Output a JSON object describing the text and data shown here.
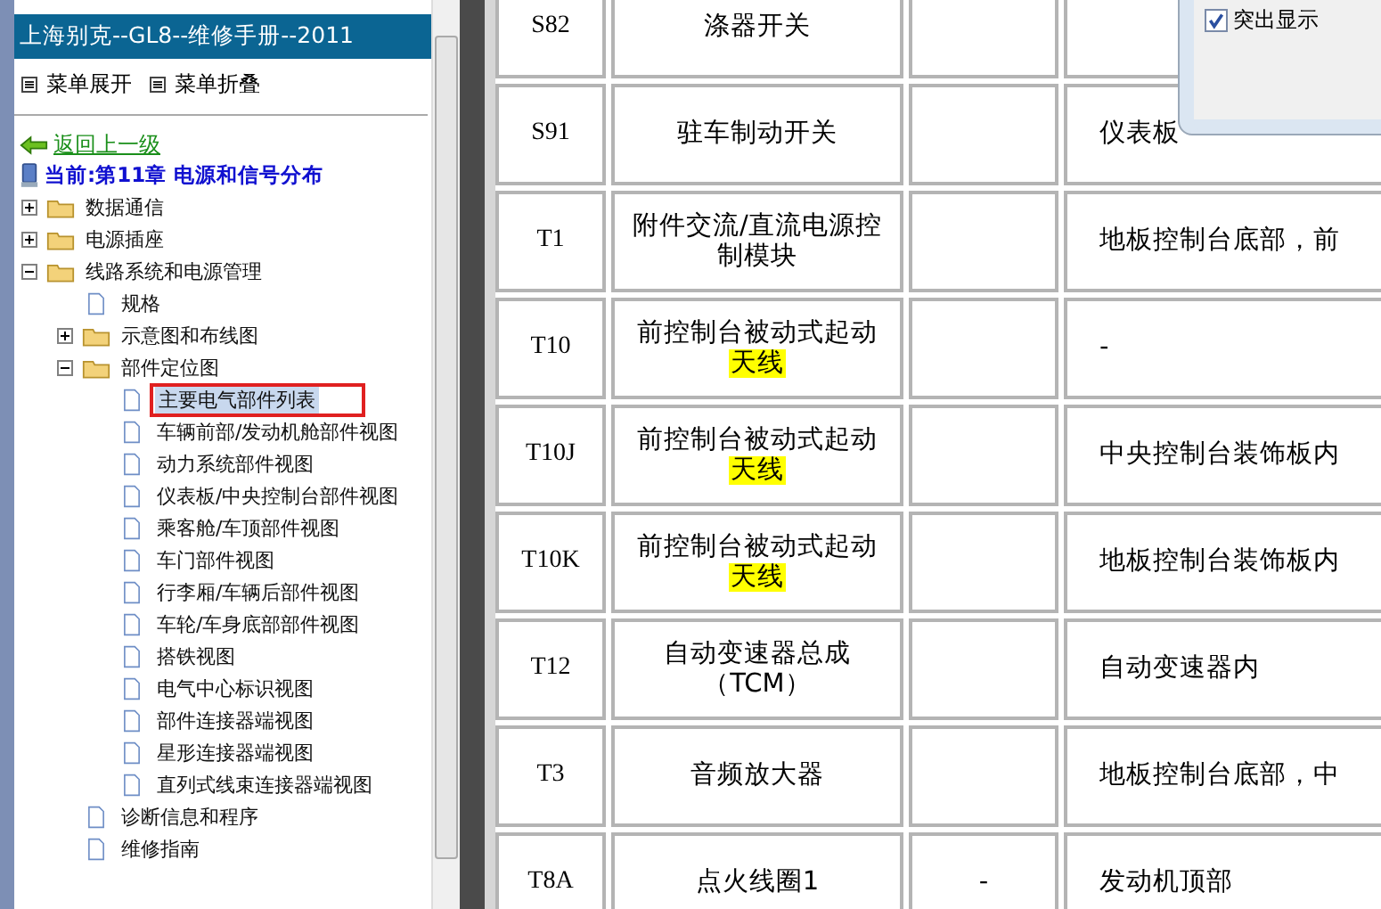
{
  "sidebar": {
    "title": "上海别克--GL8--维修手册--2011",
    "menu": [
      "菜单展开",
      "菜单折叠"
    ],
    "back_link": "返回上一级",
    "current": "当前:第11章 电源和信号分布",
    "tree": [
      {
        "label": "数据通信",
        "expanded": false
      },
      {
        "label": "电源插座",
        "expanded": false
      },
      {
        "label": "线路系统和电源管理",
        "expanded": true,
        "children": [
          {
            "label": "规格",
            "selected": false
          },
          {
            "label": "示意图和布线图",
            "expanded": false
          },
          {
            "label": "部件定位图",
            "expanded": true,
            "children": [
              {
                "label": "主要电气部件列表",
                "selected": true
              },
              {
                "label": "车辆前部/发动机舱部件视图",
                "selected": false
              },
              {
                "label": "动力系统部件视图",
                "selected": false
              },
              {
                "label": "仪表板/中央控制台部件视图",
                "selected": false
              },
              {
                "label": "乘客舱/车顶部件视图",
                "selected": false
              },
              {
                "label": "车门部件视图",
                "selected": false
              },
              {
                "label": "行李厢/车辆后部件视图",
                "selected": false
              },
              {
                "label": "车轮/车身底部部件视图",
                "selected": false
              },
              {
                "label": "搭铁视图",
                "selected": false
              },
              {
                "label": "电气中心标识视图",
                "selected": false
              },
              {
                "label": "部件连接器端视图",
                "selected": false
              },
              {
                "label": "星形连接器端视图",
                "selected": false
              },
              {
                "label": "直列式线束连接器端视图",
                "selected": false
              }
            ]
          },
          {
            "label": "诊断信息和程序",
            "selected": false
          },
          {
            "label": "维修指南",
            "selected": false
          }
        ]
      }
    ]
  },
  "table": {
    "rows": [
      {
        "code": "S82",
        "name": "涤器开关",
        "column_3": "",
        "location": ""
      },
      {
        "code": "S91",
        "name": "驻车制动开关",
        "column_3": "",
        "location": "仪表板"
      },
      {
        "code": "T1",
        "name": "附件交流/直流电源控制模块",
        "column_3": "",
        "location": "地板控制台底部，前"
      },
      {
        "code": "T10",
        "name": "前控制台被动式起动",
        "highlight": "天线",
        "column_3": "",
        "location": "-"
      },
      {
        "code": "T10J",
        "name": "前控制台被动式起动",
        "highlight": "天线",
        "column_3": "",
        "location": "中央控制台装饰板内"
      },
      {
        "code": "T10K",
        "name": "前控制台被动式起动",
        "highlight": "天线",
        "column_3": "",
        "location": "地板控制台装饰板内"
      },
      {
        "code": "T12",
        "name": "自动变速器总成（TCM）",
        "column_3": "",
        "location": "自动变速器内"
      },
      {
        "code": "T3",
        "name": "音频放大器",
        "column_3": "",
        "location": "地板控制台底部，中"
      },
      {
        "code": "T8A",
        "name": "点火线圈1",
        "column_3": "-",
        "location": "发动机顶部"
      }
    ]
  },
  "dialog": {
    "checkbox": {
      "label": "突出显示",
      "checked": true
    }
  }
}
